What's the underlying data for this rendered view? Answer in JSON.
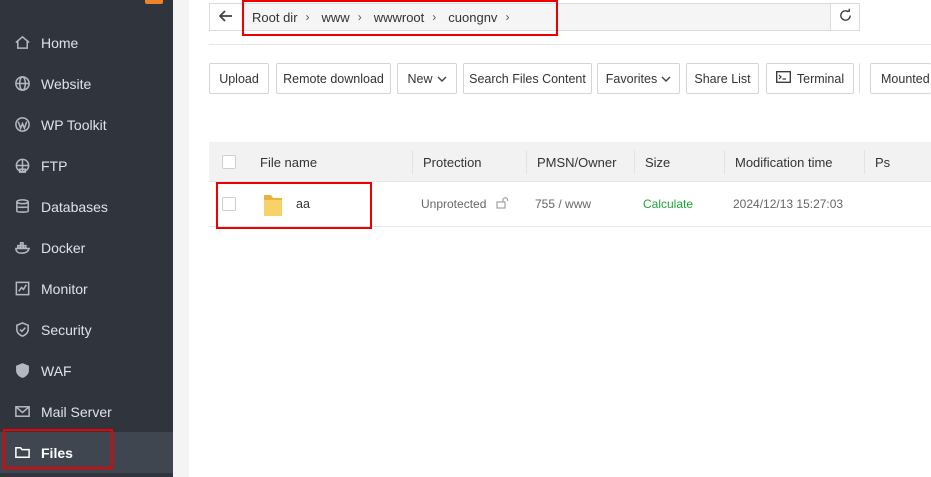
{
  "sidebar": {
    "items": [
      {
        "label": "Home",
        "icon": "home-icon"
      },
      {
        "label": "Website",
        "icon": "globe-icon"
      },
      {
        "label": "WP Toolkit",
        "icon": "wordpress-icon"
      },
      {
        "label": "FTP",
        "icon": "ftp-icon"
      },
      {
        "label": "Databases",
        "icon": "database-icon"
      },
      {
        "label": "Docker",
        "icon": "docker-icon"
      },
      {
        "label": "Monitor",
        "icon": "monitor-icon"
      },
      {
        "label": "Security",
        "icon": "shield-icon"
      },
      {
        "label": "WAF",
        "icon": "waf-shield-icon"
      },
      {
        "label": "Mail Server",
        "icon": "mail-icon"
      },
      {
        "label": "Files",
        "icon": "folder-icon",
        "active": true
      }
    ]
  },
  "path": {
    "crumbs": [
      "Root dir",
      "www",
      "wwwroot",
      "cuongnv"
    ]
  },
  "toolbar": {
    "upload": "Upload",
    "remote_download": "Remote download",
    "new": "New",
    "search_files_content": "Search Files Content",
    "favorites": "Favorites",
    "share_list": "Share List",
    "terminal": "Terminal",
    "mounted": "Mounted"
  },
  "table": {
    "headers": {
      "file_name": "File name",
      "protection": "Protection",
      "permission_owner": "PMSN/Owner",
      "size": "Size",
      "modification_time": "Modification time",
      "ps": "Ps"
    },
    "rows": [
      {
        "name": "aa",
        "protection": "Unprotected",
        "permission_owner": "755 / www",
        "size": "Calculate",
        "modification_time": "2024/12/13 15:27:03"
      }
    ]
  },
  "colors": {
    "sidebar_bg": "#30353d",
    "active_bg": "#3f4650",
    "highlight": "#e00000",
    "size_link": "#20a53a",
    "folder": "#f4c64e"
  }
}
